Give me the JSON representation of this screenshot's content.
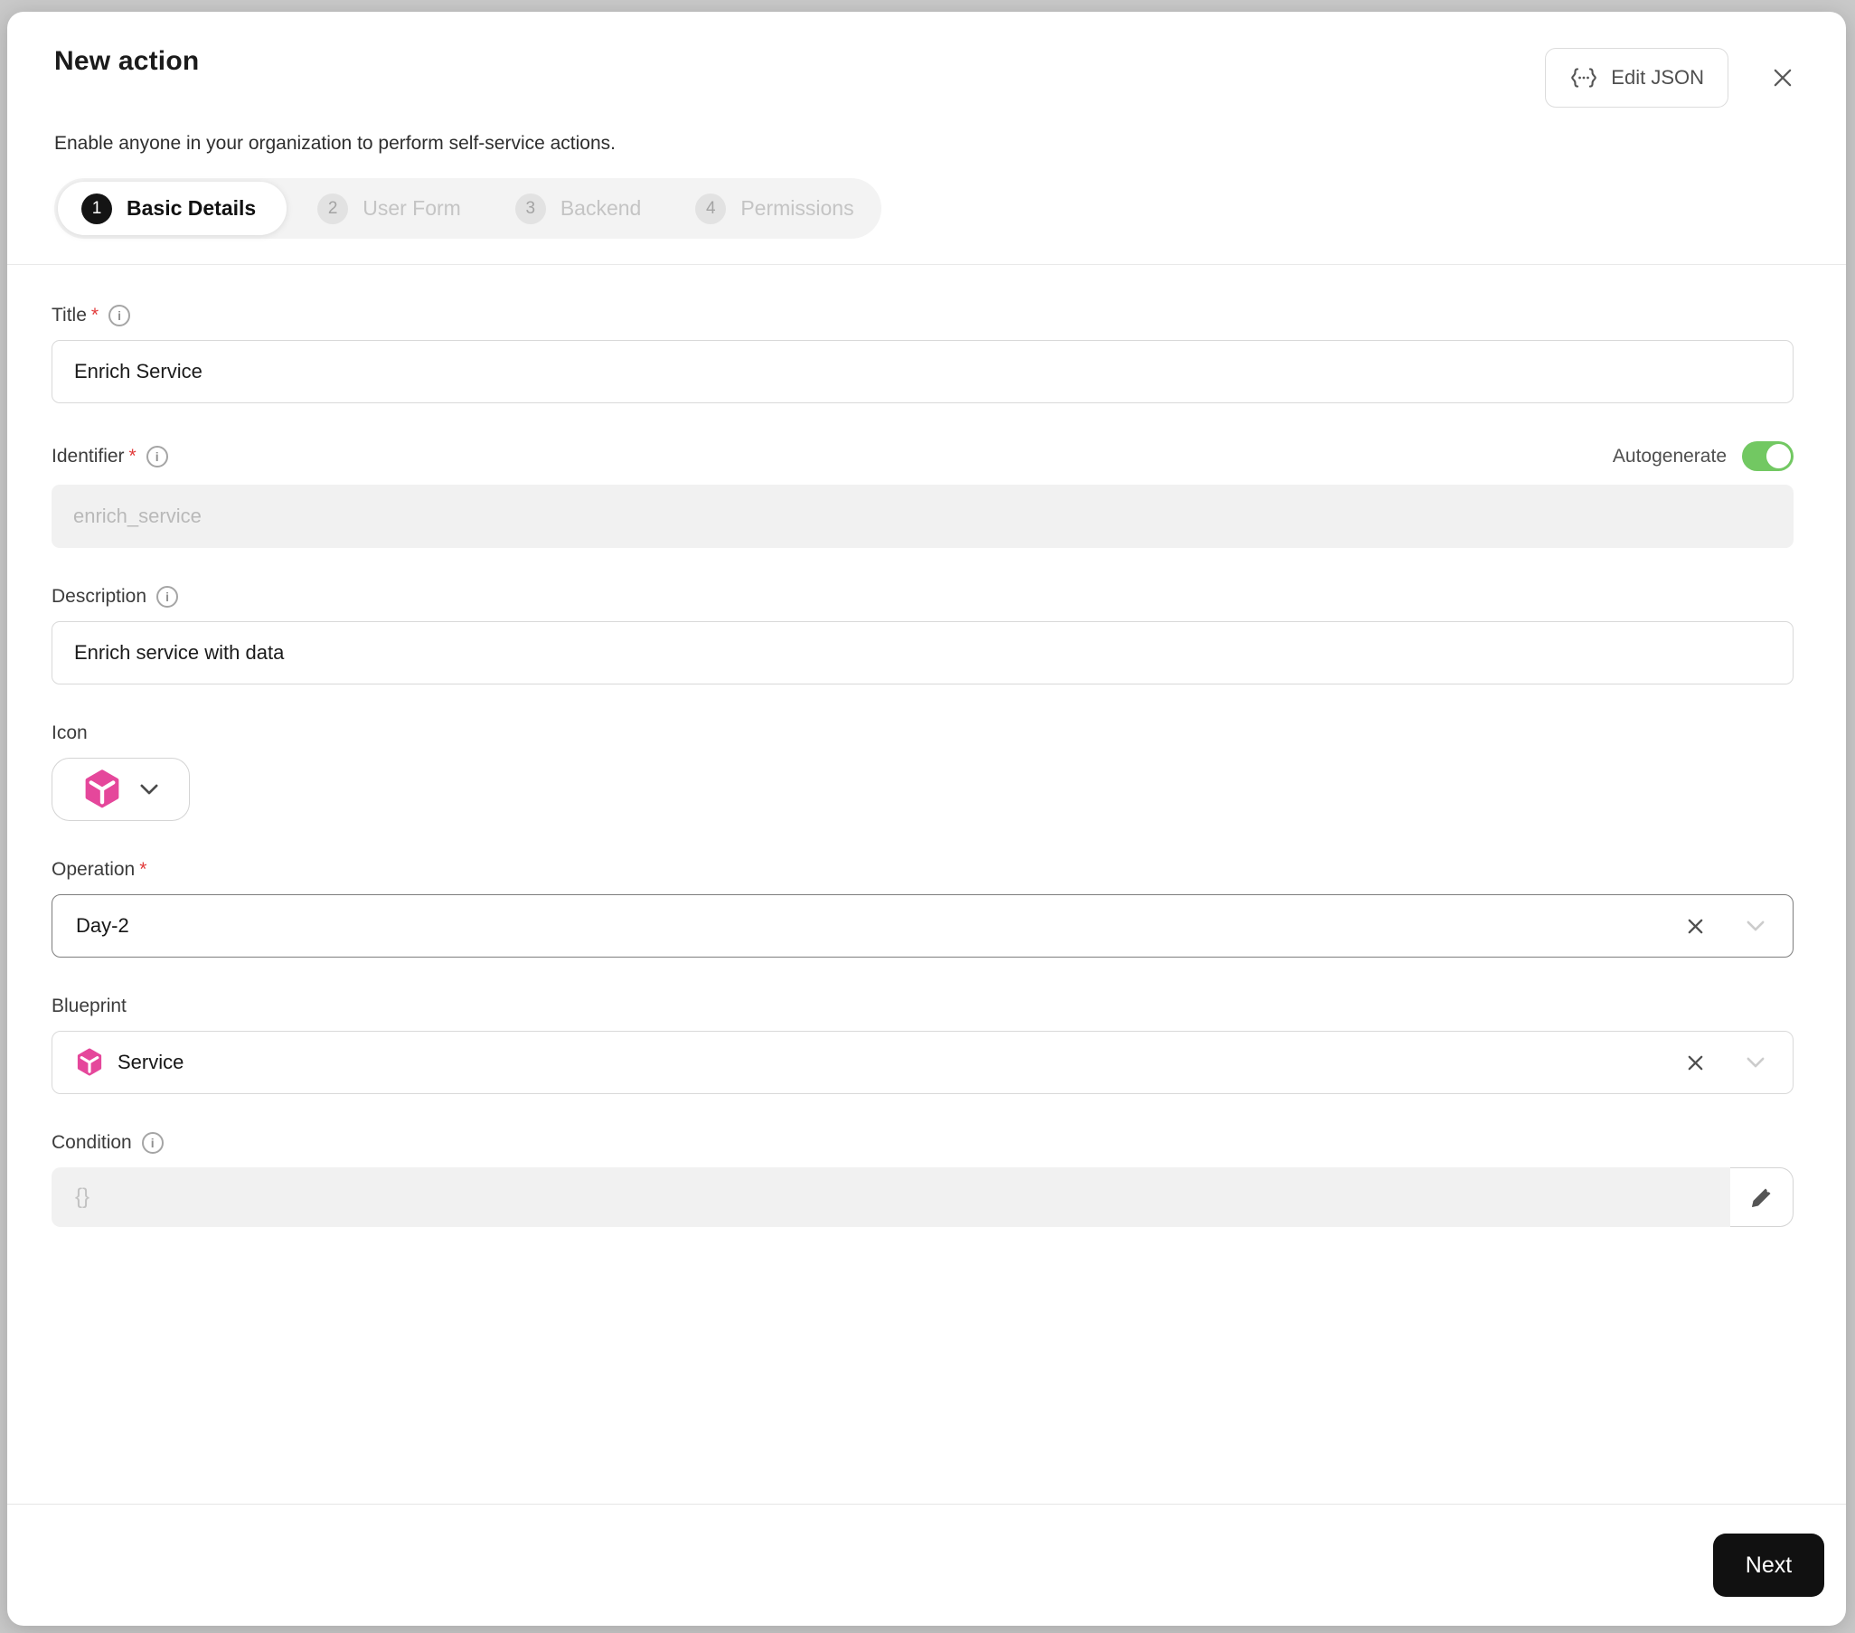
{
  "header": {
    "title": "New action",
    "subtitle": "Enable anyone in your organization to perform self-service actions.",
    "edit_json_label": "Edit JSON"
  },
  "stepper": {
    "steps": [
      {
        "number": "1",
        "label": "Basic Details",
        "active": true
      },
      {
        "number": "2",
        "label": "User Form",
        "active": false
      },
      {
        "number": "3",
        "label": "Backend",
        "active": false
      },
      {
        "number": "4",
        "label": "Permissions",
        "active": false
      }
    ]
  },
  "form": {
    "title": {
      "label": "Title",
      "required": "*",
      "value": "Enrich Service"
    },
    "identifier": {
      "label": "Identifier",
      "required": "*",
      "value": "enrich_service",
      "autogenerate_label": "Autogenerate",
      "autogenerate_on": true
    },
    "description": {
      "label": "Description",
      "value": "Enrich service with data"
    },
    "icon": {
      "label": "Icon",
      "selected_icon": "cube-icon"
    },
    "operation": {
      "label": "Operation",
      "required": "*",
      "value": "Day-2"
    },
    "blueprint": {
      "label": "Blueprint",
      "value": "Service",
      "icon": "cube-icon"
    },
    "condition": {
      "label": "Condition",
      "placeholder": "{}"
    }
  },
  "footer": {
    "next_label": "Next"
  },
  "colors": {
    "accent_pink": "#E5479B",
    "toggle_green": "#72C862",
    "active_step": "#141414",
    "required_red": "#E23B3B",
    "next_button": "#111111"
  }
}
